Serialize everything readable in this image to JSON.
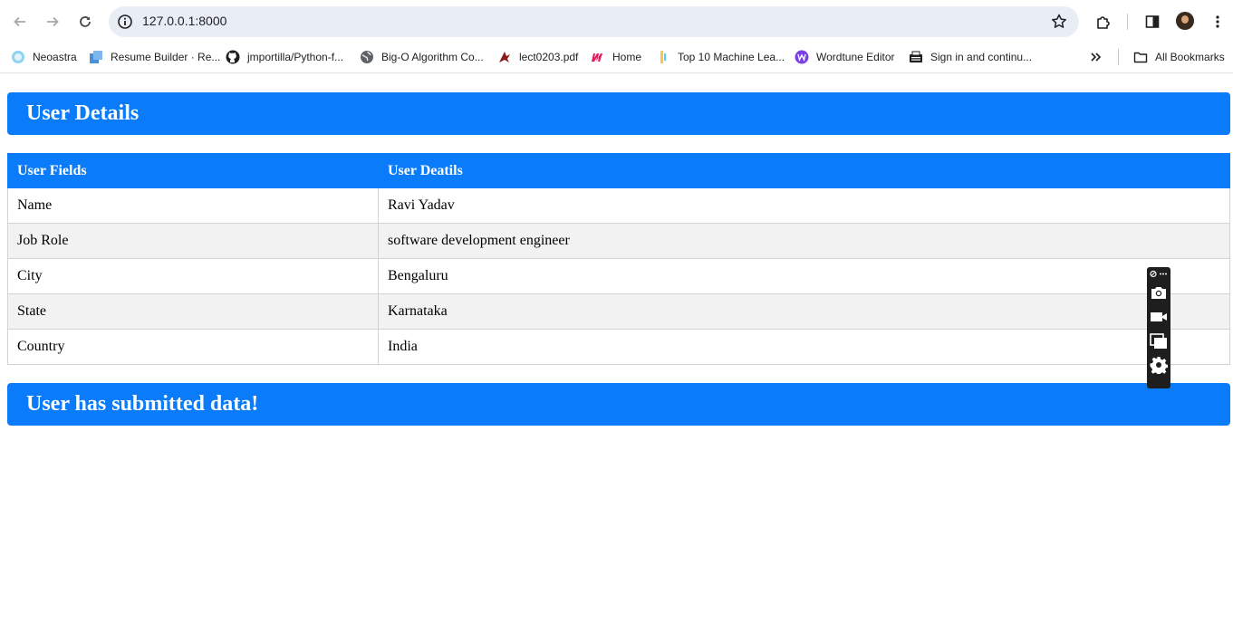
{
  "browser": {
    "url": "127.0.0.1:8000",
    "bookmarks": [
      {
        "label": "Neoastra",
        "icon": "neoastra-icon"
      },
      {
        "label": "Resume Builder · Re...",
        "icon": "resume-builder-icon"
      },
      {
        "label": "jmportilla/Python-f...",
        "icon": "github-icon"
      },
      {
        "label": "Big-O Algorithm Co...",
        "icon": "globe-icon"
      },
      {
        "label": "lect0203.pdf",
        "icon": "pdf-bird-icon"
      },
      {
        "label": "Home",
        "icon": "m-logo-icon"
      },
      {
        "label": "Top 10 Machine Lea...",
        "icon": "bookmark-bar-icon"
      },
      {
        "label": "Wordtune Editor",
        "icon": "wordtune-icon"
      },
      {
        "label": "Sign in and continu...",
        "icon": "typewriter-icon"
      }
    ],
    "all_bookmarks_label": "All Bookmarks"
  },
  "page": {
    "title": "User Details",
    "table": {
      "headers": [
        "User Fields",
        "User Deatils"
      ],
      "rows": [
        [
          "Name",
          "Ravi Yadav"
        ],
        [
          "Job Role",
          "software development engineer"
        ],
        [
          "City",
          "Bengaluru"
        ],
        [
          "State",
          "Karnataka"
        ],
        [
          "Country",
          "India"
        ]
      ]
    },
    "footer_message": "User has submitted data!"
  },
  "colors": {
    "accent": "#0a7bf9",
    "row_alt": "#f2f2f2",
    "overlay_bg": "#1e1e1e"
  }
}
